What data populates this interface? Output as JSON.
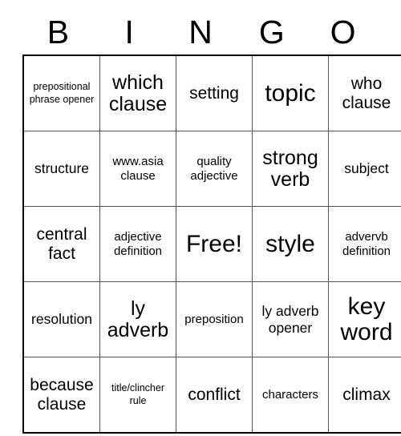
{
  "card": {
    "title": "BINGO",
    "header_letters": [
      "B",
      "I",
      "N",
      "G",
      "O"
    ],
    "columns": 5,
    "rows": 5,
    "free_space_label": "Free!",
    "free_space_position": {
      "row": 3,
      "column": 3
    },
    "border_color": "#000000",
    "gridline_color": "#555555",
    "background_color": "#ffffff",
    "text_color": "#000000",
    "grid": [
      [
        {
          "text": "prepositional phrase opener",
          "size": "xs"
        },
        {
          "text": "which clause",
          "size": "xl"
        },
        {
          "text": "setting",
          "size": "lg"
        },
        {
          "text": "topic",
          "size": "xxl"
        },
        {
          "text": "who clause",
          "size": "lg"
        }
      ],
      [
        {
          "text": "structure",
          "size": "md"
        },
        {
          "text": "www.asia clause",
          "size": "sm"
        },
        {
          "text": "quality adjective",
          "size": "sm"
        },
        {
          "text": "strong verb",
          "size": "xl"
        },
        {
          "text": "subject",
          "size": "md"
        }
      ],
      [
        {
          "text": "central fact",
          "size": "lg"
        },
        {
          "text": "adjective definition",
          "size": "sm"
        },
        {
          "text": "Free!",
          "size": "xxl"
        },
        {
          "text": "style",
          "size": "xxl"
        },
        {
          "text": "advervb definition",
          "size": "sm"
        }
      ],
      [
        {
          "text": "resolution",
          "size": "md"
        },
        {
          "text": "ly adverb",
          "size": "xl"
        },
        {
          "text": "preposition",
          "size": "sm"
        },
        {
          "text": "ly adverb opener",
          "size": "md"
        },
        {
          "text": "key word",
          "size": "xxl"
        }
      ],
      [
        {
          "text": "because clause",
          "size": "lg"
        },
        {
          "text": "title/clincher rule",
          "size": "xs"
        },
        {
          "text": "conflict",
          "size": "lg"
        },
        {
          "text": "characters",
          "size": "sm"
        },
        {
          "text": "climax",
          "size": "lg"
        }
      ]
    ]
  }
}
